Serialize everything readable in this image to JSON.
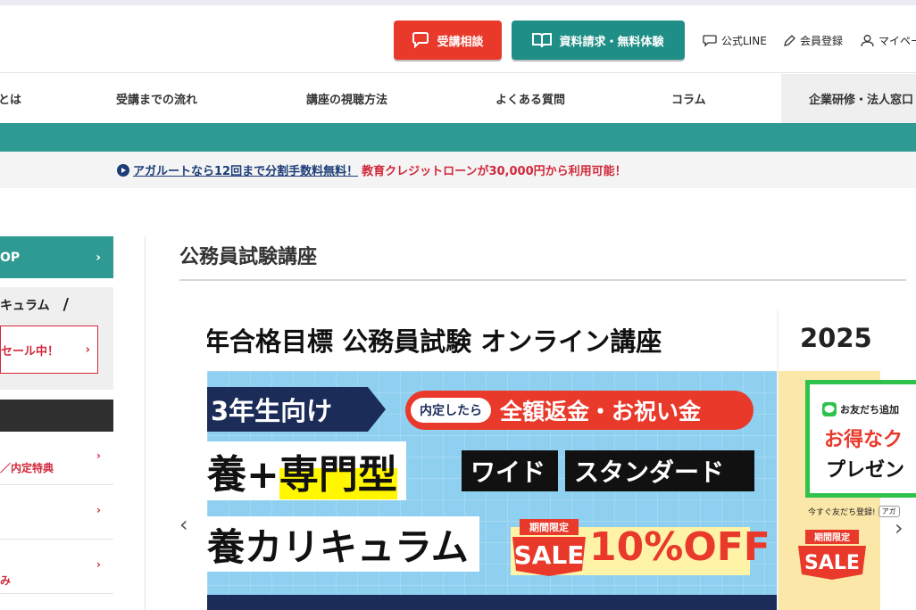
{
  "header": {
    "consult_label": "受講相談",
    "request_label": "資料請求・無料体験",
    "line_label": "公式LINE",
    "member_label": "会員登録",
    "mypage_label": "マイペー"
  },
  "nav": {
    "items": [
      {
        "label": "とは"
      },
      {
        "label": "受講までの流れ"
      },
      {
        "label": "講座の視聴方法"
      },
      {
        "label": "よくある質問"
      },
      {
        "label": "コラム"
      },
      {
        "label": "企業研修・法人窓口"
      }
    ]
  },
  "notice": {
    "link_text": "アガルートなら12回まで分割手数料無料！",
    "extra_text": "教育クレジットローンが30,000円から利用可能！"
  },
  "sidebar": {
    "top_label": "OP",
    "curriculum_label": "キュラム",
    "sale_label": "セール中！",
    "links": [
      {
        "label": "／内定特典"
      },
      {
        "label": ""
      },
      {
        "label": "み"
      }
    ]
  },
  "main": {
    "page_title": "公務員試験講座"
  },
  "slide": {
    "heading": "年合格目標 公務員試験 オンライン講座",
    "grade": "3年生向け",
    "refund_pill": "内定したら",
    "refund_text": "全額返金・お祝い金",
    "type_prefix": "養+",
    "type_highlight": "専門型",
    "tag_wide": "ワイド",
    "tag_standard": "スタンダード",
    "curriculum": "養カリキュラム",
    "sale_badge_top": "期間限定",
    "sale_badge_main": "SALE",
    "discount": "10%OFF"
  },
  "slide2": {
    "year": "2025",
    "sale_badge_top": "期間限定",
    "sale_badge_main": "SALE"
  },
  "line_popup": {
    "line1": "お友だち追加",
    "line2": "お得なク",
    "line3": "プレゼン",
    "footer": "今すぐ友だち登録!",
    "footer_mini": "アガ"
  },
  "carousel": {
    "prev_symbol": "‹",
    "next_symbol": "›"
  },
  "colors": {
    "teal": "#2e9a93",
    "red": "#e8392b",
    "navy": "#1c2c59",
    "line_green": "#2ec24b"
  }
}
